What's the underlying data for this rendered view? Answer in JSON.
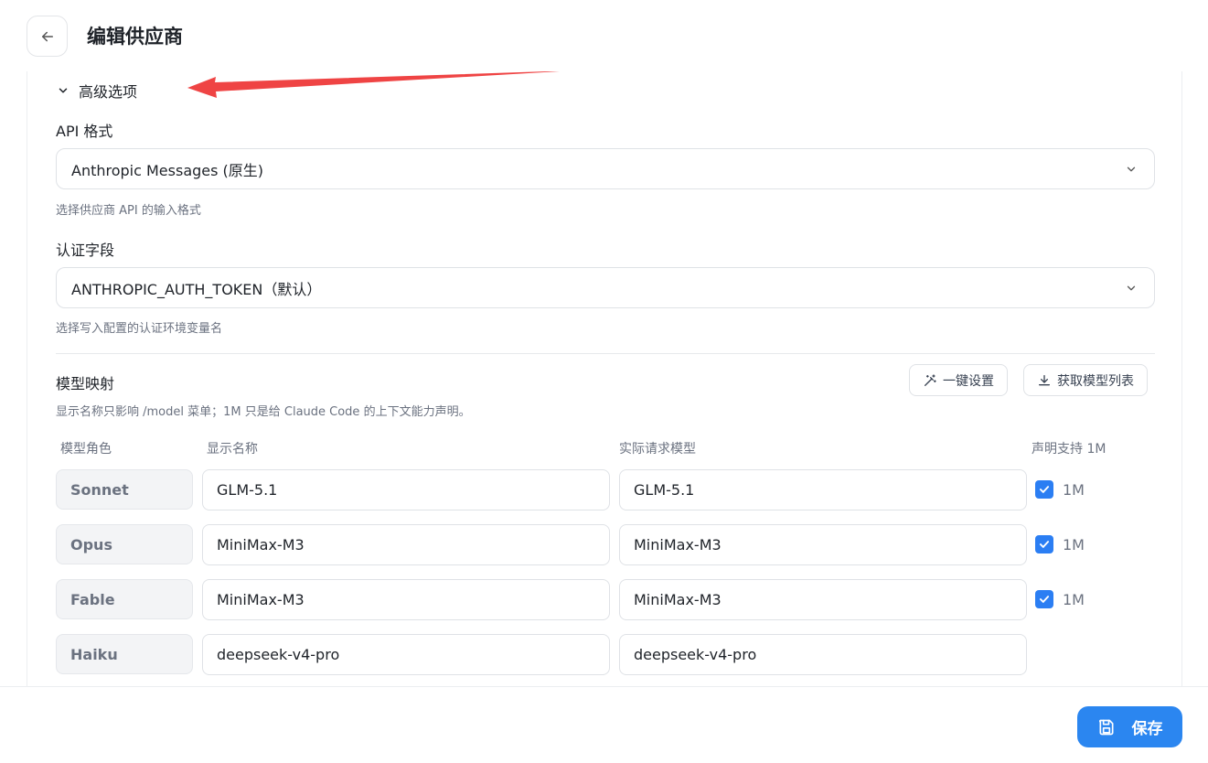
{
  "header": {
    "title": "编辑供应商"
  },
  "advanced": {
    "title": "高级选项"
  },
  "api_format": {
    "label": "API 格式",
    "value": "Anthropic Messages (原生)",
    "hint": "选择供应商 API 的输入格式"
  },
  "auth_field": {
    "label": "认证字段",
    "value": "ANTHROPIC_AUTH_TOKEN（默认）",
    "hint": "选择写入配置的认证环境变量名"
  },
  "model_mapping": {
    "title": "模型映射",
    "hint": "显示名称只影响 /model 菜单；1M 只是给 Claude Code 的上下文能力声明。",
    "one_click_label": "一键设置",
    "fetch_models_label": "获取模型列表",
    "columns": {
      "role": "模型角色",
      "display": "显示名称",
      "actual": "实际请求模型",
      "support": "声明支持 1M"
    },
    "rows": [
      {
        "role": "Sonnet",
        "display": "GLM-5.1",
        "actual": "GLM-5.1",
        "checked": true,
        "check_label": "1M"
      },
      {
        "role": "Opus",
        "display": "MiniMax-M3",
        "actual": "MiniMax-M3",
        "checked": true,
        "check_label": "1M"
      },
      {
        "role": "Fable",
        "display": "MiniMax-M3",
        "actual": "MiniMax-M3",
        "checked": true,
        "check_label": "1M"
      },
      {
        "role": "Haiku",
        "display": "deepseek-v4-pro",
        "actual": "deepseek-v4-pro",
        "checked": false,
        "check_label": ""
      }
    ]
  },
  "footer": {
    "save_label": "保存"
  },
  "colors": {
    "accent": "#2b86f0",
    "checkbox": "#2b7ef3",
    "annotation_arrow": "#ef4444"
  },
  "icons": {
    "back": "arrow-left-icon",
    "chevron": "chevron-down-icon",
    "wand": "magic-wand-icon",
    "download": "download-icon",
    "save": "floppy-disk-icon"
  }
}
